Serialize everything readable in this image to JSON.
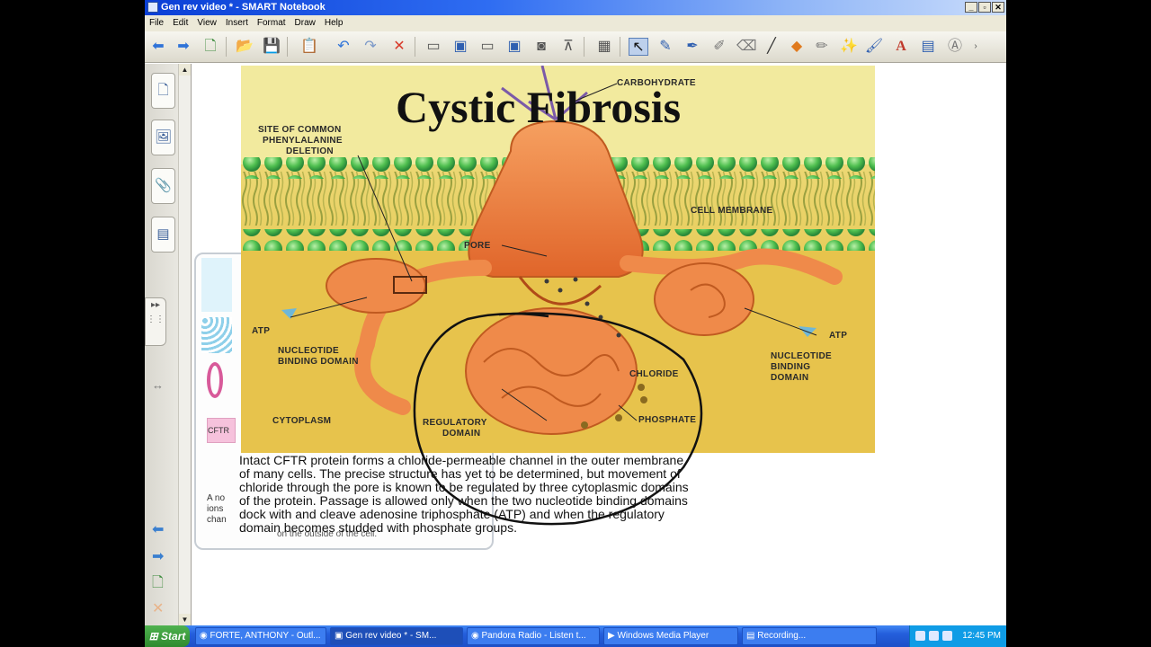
{
  "window": {
    "title": "Gen rev video * - SMART Notebook",
    "controls": [
      "_",
      "▫",
      "✕"
    ]
  },
  "menu": [
    "File",
    "Edit",
    "View",
    "Insert",
    "Format",
    "Draw",
    "Help"
  ],
  "overlay_panel": {
    "label_cftr": "CFTR",
    "text_lines": [
      "A no",
      "ions",
      "chan"
    ],
    "bottom_text": "on the outside of the cell."
  },
  "slide": {
    "title": "Cystic Fibrosis",
    "labels": {
      "carbohydrate": "CARBOHYDRATE",
      "site_line1": "SITE OF COMMON",
      "site_line2": "PHENYLALANINE",
      "site_line3": "DELETION",
      "cell_membrane": "CELL MEMBRANE",
      "pore": "PORE",
      "atp_left": "ATP",
      "atp_right": "ATP",
      "nbd_left_line1": "NUCLEOTIDE",
      "nbd_left_line2": "BINDING DOMAIN",
      "nbd_right_line1": "NUCLEOTIDE",
      "nbd_right_line2": "BINDING",
      "nbd_right_line3": "DOMAIN",
      "chloride": "CHLORIDE",
      "cytoplasm": "CYTOPLASM",
      "regulatory_line1": "REGULATORY",
      "regulatory_line2": "DOMAIN",
      "phosphate": "PHOSPHATE"
    },
    "caption": [
      "Intact CFTR protein forms a chloride-permeable channel in the outer membrane",
      "of many cells. The precise structure has yet to be determined, but movement of",
      "chloride through the pore is known to be regulated by three cytoplasmic domains",
      "of the protein. Passage is allowed only when the two nucleotide binding domains",
      "dock with and cleave adenosine triphosphate (ATP) and when the regulatory",
      "domain becomes studded with phosphate groups."
    ]
  },
  "taskbar": {
    "start": "Start",
    "tasks": [
      "FORTE, ANTHONY - Outl...",
      "Gen rev video * - SM...",
      "Pandora Radio - Listen t...",
      "Windows Media Player",
      "Recording..."
    ],
    "clock": "12:45 PM"
  },
  "colors": {
    "titlebar": "#2f6df2",
    "protein": "#ef7e3a",
    "membrane_bead": "#5cc85c",
    "figure_bg": "#e6c850",
    "taskbar": "#245edb"
  }
}
